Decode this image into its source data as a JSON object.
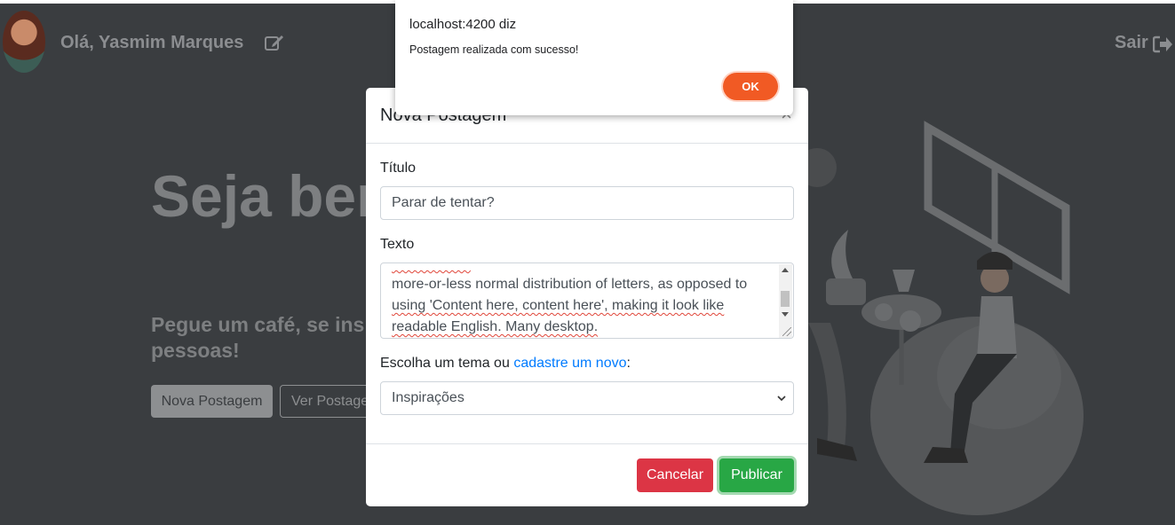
{
  "header": {
    "greeting": "Olá, Yasmim Marques",
    "logout_label": "Sair"
  },
  "hero": {
    "title": "Seja bem vindo(a)!",
    "subtitle": "Pegue um café, se inspire e inspire pessoas!",
    "new_post_button": "Nova Postagem",
    "see_posts_button": "Ver Postagens"
  },
  "modal": {
    "title": "Nova Postagem",
    "title_label": "Título",
    "title_value": "Parar de tentar?",
    "text_label": "Texto",
    "text_line1": "more-or-less normal distribution of letters, as opposed to",
    "text_line2": "using 'Content here, content here', making it look like",
    "text_line3": "readable English. Many desktop.",
    "theme_label_prefix": "Escolha um tema ou",
    "theme_link": "cadastre um novo",
    "theme_label_suffix": ":",
    "theme_selected": "Inspirações",
    "cancel_button": "Cancelar",
    "publish_button": "Publicar"
  },
  "alert": {
    "title": "localhost:4200 diz",
    "message": "Postagem realizada com sucesso!",
    "ok_button": "OK"
  },
  "colors": {
    "overlay_bg": "#3a3d40",
    "danger": "#dc3545",
    "success": "#28a745",
    "link": "#007bff",
    "alert_ok": "#f15a24"
  },
  "icons": [
    "edit-icon",
    "logout-icon",
    "close-icon",
    "chevron-down-icon"
  ]
}
